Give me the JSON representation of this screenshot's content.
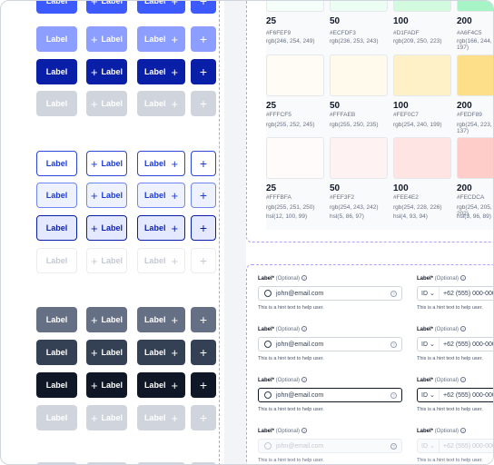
{
  "button_label": "Label",
  "colors": [
    {
      "name": "25",
      "hex": "#F6FEF9",
      "rgb": "rgb(246, 254, 249)",
      "fill": "#f6fef9"
    },
    {
      "name": "50",
      "hex": "#ECFDF3",
      "rgb": "rgb(236, 253, 243)",
      "fill": "#ecfdf3"
    },
    {
      "name": "100",
      "hex": "#D1FADF",
      "rgb": "rgb(209, 250, 223)",
      "fill": "#d1fadf"
    },
    {
      "name": "200",
      "hex": "#A6F4C5",
      "rgb": "rgb(166, 244, 197)",
      "fill": "#a6f4c5"
    },
    {
      "name": "25",
      "hex": "#FFFCF5",
      "rgb": "rgb(255, 252, 245)",
      "fill": "#fffcf5"
    },
    {
      "name": "50",
      "hex": "#FFFAEB",
      "rgb": "rgb(255, 250, 235)",
      "fill": "#fffaeb"
    },
    {
      "name": "100",
      "hex": "#FEF0C7",
      "rgb": "rgb(254, 240, 199)",
      "fill": "#fef0c7"
    },
    {
      "name": "200",
      "hex": "#FEDF89",
      "rgb": "rgb(254, 223, 137)",
      "fill": "#fedf89"
    },
    {
      "name": "25",
      "hex": "#FFFBFA",
      "rgb": "rgb(255, 251, 250)",
      "hsl": "hsl(12, 100, 99)",
      "fill": "#fffbfa"
    },
    {
      "name": "50",
      "hex": "#FEF3F2",
      "rgb": "rgb(254, 243, 242)",
      "hsl": "hsl(5, 86, 97)",
      "fill": "#fef3f2"
    },
    {
      "name": "100",
      "hex": "#FEE4E2",
      "rgb": "rgb(254, 228, 226)",
      "hsl": "hsl(4, 93, 94)",
      "fill": "#fee4e2"
    },
    {
      "name": "200",
      "hex": "#FECDCA",
      "rgb": "rgb(254, 205, 202)",
      "hsl": "hsl(3, 96, 89)",
      "fill": "#fecdca"
    }
  ],
  "form": {
    "label": "Label*",
    "optional": "(Optional)",
    "email_value": "john@email.com",
    "hint": "This is a hint text to help user.",
    "country_code": "ID",
    "phone_value": "+62 (555) 000-0000"
  }
}
